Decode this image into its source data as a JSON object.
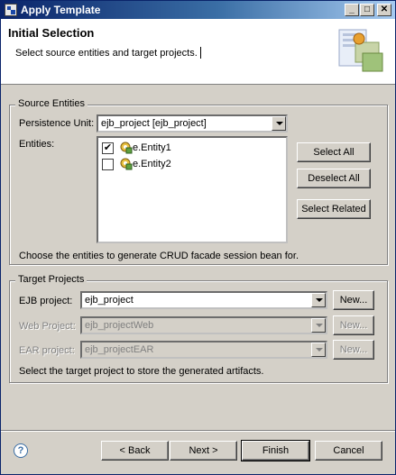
{
  "window": {
    "title": "Apply Template",
    "minimize_glyph": "_",
    "maximize_glyph": "□",
    "close_glyph": "✕"
  },
  "header": {
    "title": "Initial Selection",
    "description": "Select source entities and target projects."
  },
  "source_entities": {
    "legend": "Source Entities",
    "persistence_unit_label": "Persistence Unit:",
    "persistence_unit_value": "ejb_project [ejb_project]",
    "entities_label": "Entities:",
    "entities": [
      {
        "name": "e.Entity1",
        "checked": true
      },
      {
        "name": "e.Entity2",
        "checked": false
      }
    ],
    "select_all": "Select All",
    "deselect_all": "Deselect All",
    "select_related": "Select Related",
    "hint": "Choose the entities to generate CRUD facade session bean for."
  },
  "target_projects": {
    "legend": "Target Projects",
    "ejb_label": "EJB project:",
    "ejb_value": "ejb_project",
    "web_label": "Web Project:",
    "web_value": "ejb_projectWeb",
    "ear_label": "EAR project:",
    "ear_value": "ejb_projectEAR",
    "new_label": "New...",
    "hint": "Select the target project to store the generated artifacts."
  },
  "footer": {
    "help_glyph": "?",
    "back": "< Back",
    "next": "Next >",
    "finish": "Finish",
    "cancel": "Cancel"
  },
  "colors": {
    "titlebar": "#0a246a",
    "dialog_bg": "#d4d0c8",
    "disabled_text": "#808080"
  },
  "icons": [
    "app-icon",
    "wizard-banner-icon",
    "entity-bean-icon",
    "help-icon",
    "dropdown-arrow-icon"
  ]
}
